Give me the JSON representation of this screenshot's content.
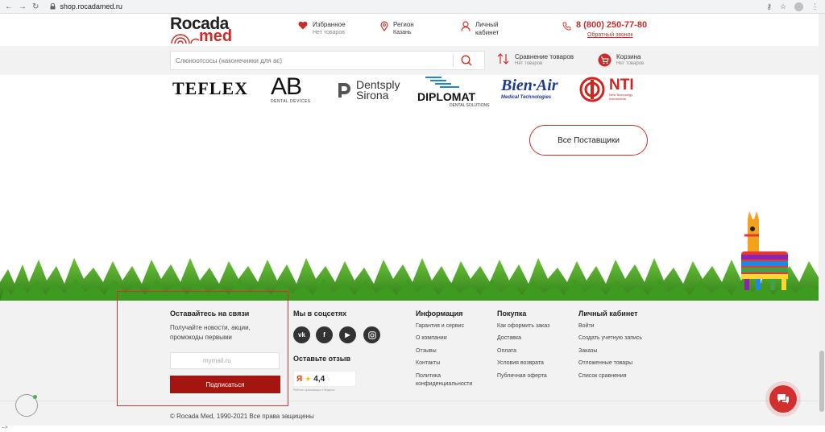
{
  "browser": {
    "url": "shop.rocadamed.ru",
    "status_text": "-->"
  },
  "header": {
    "logo": {
      "top": "Rocada",
      "bottom": "med"
    },
    "favorites": {
      "title": "Избранное",
      "subtitle": "Нет товаров"
    },
    "region": {
      "title": "Регион",
      "subtitle": "Казань"
    },
    "account": {
      "title": "Личный",
      "subtitle": "кабинет"
    },
    "phone": {
      "number": "8 (800) 250-77-80",
      "callback": "Обратный звонок"
    }
  },
  "search": {
    "placeholder": "Слюноотсосы (наконечники для ас)"
  },
  "compare": {
    "title": "Сравнение товаров",
    "subtitle": "Нет товаров"
  },
  "cart": {
    "title": "Корзина",
    "subtitle": "Нет товаров"
  },
  "brands": {
    "teflex": "TEFLEX",
    "ab": {
      "name": "AB",
      "sub": "DENTAL DEVICES"
    },
    "dentsply": {
      "line1": "Dentsply",
      "line2": "Sirona"
    },
    "diplomat": {
      "name": "DIPLOMAT",
      "sub": "DENTAL SOLUTIONS"
    },
    "bienair": {
      "name": "Bien·Air",
      "sub": "Medical Technologies"
    },
    "nti": {
      "name": "NTI",
      "sub1": "New Technology",
      "sub2": "Instruments"
    }
  },
  "all_suppliers_label": "Все Поставщики",
  "footer": {
    "newsletter": {
      "title": "Оставайтесь на связи",
      "text_line1": "Получайте новости, акции,",
      "text_line2": "промокоды первыми",
      "email_placeholder": "mymail.ru",
      "subscribe_label": "Подписаться"
    },
    "social": {
      "title": "Мы в соцсетях",
      "icons": [
        "vk-icon",
        "facebook-icon",
        "youtube-icon",
        "instagram-icon"
      ],
      "review_title": "Оставьте отзыв",
      "rating": "4,4",
      "rating_caption": "Рейтинг организации в Яндексе"
    },
    "info": {
      "title": "Информация",
      "links": [
        "Гарантия и сервис",
        "О компании",
        "Отзывы",
        "Контакты",
        "Политика",
        "конфиденциальности"
      ]
    },
    "purchase": {
      "title": "Покупка",
      "links": [
        "Как оформить заказ",
        "Доставка",
        "Оплата",
        "Условия возврата",
        "Публичная оферта"
      ]
    },
    "cabinet": {
      "title": "Личный кабинет",
      "links": [
        "Войти",
        "Создать учетную запись",
        "Заказы",
        "Отложенные товары",
        "Список сравнения"
      ]
    },
    "copyright": "© Rocada Med, 1990-2021 Все права защищены"
  },
  "colors": {
    "brand_red": "#c7302a",
    "button_dark_red": "#a5150f",
    "footer_bg": "#f2f2f2"
  }
}
